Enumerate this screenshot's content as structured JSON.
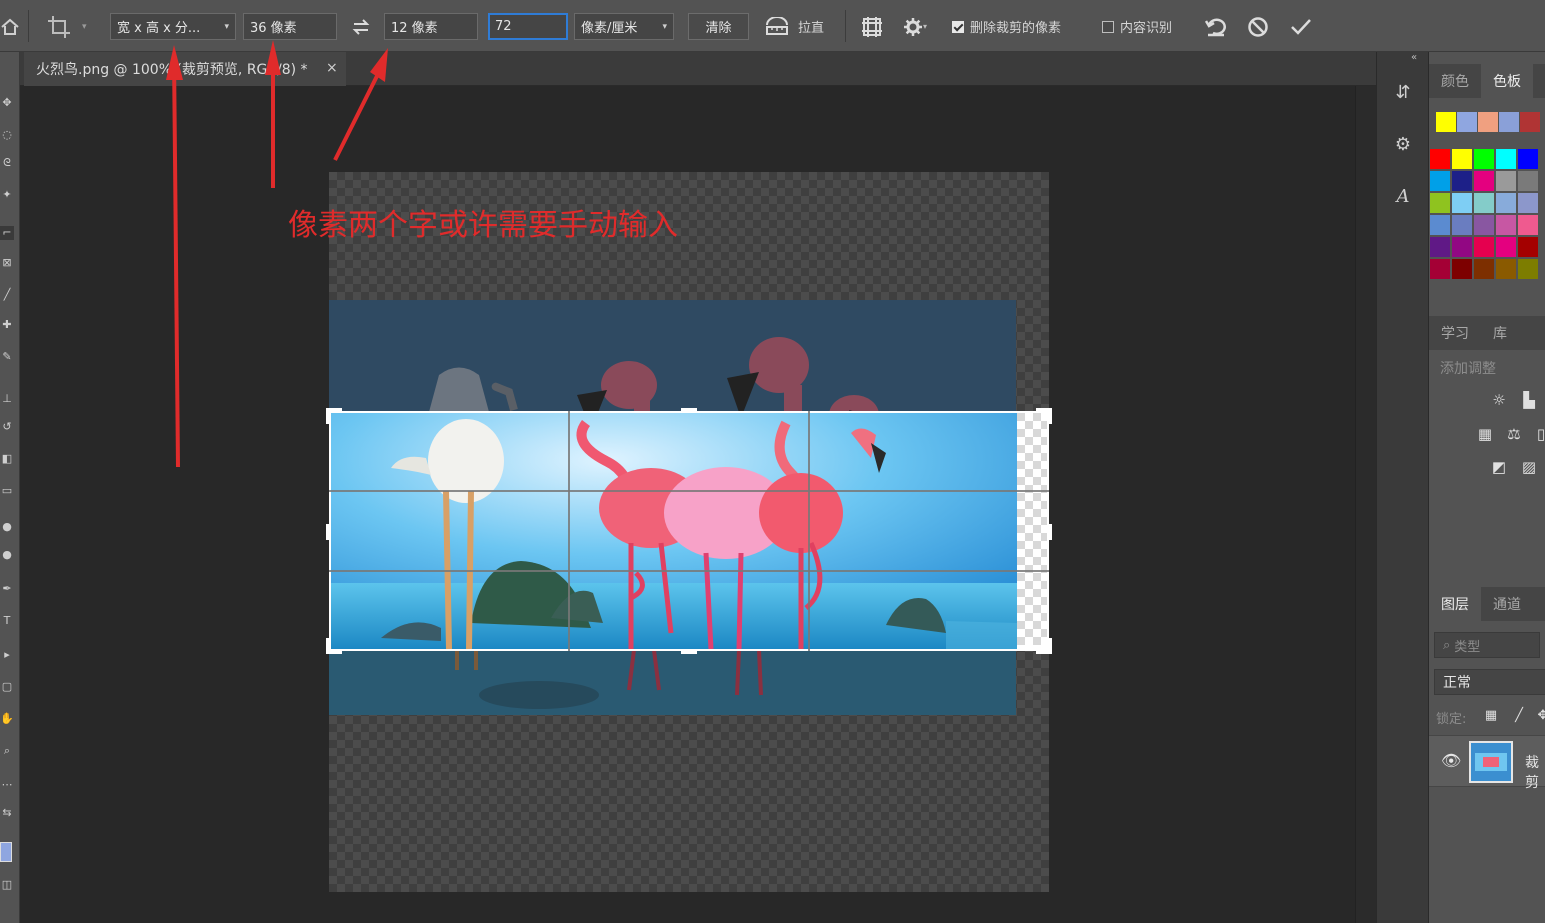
{
  "options_bar": {
    "ratio_preset": "宽 x 高 x 分...",
    "width_value": "36 像素",
    "height_value": "12 像素",
    "resolution_value": "72",
    "resolution_unit": "像素/厘米",
    "clear_label": "清除",
    "straighten_label": "拉直",
    "delete_cropped_label": "删除裁剪的像素",
    "delete_cropped_checked": true,
    "content_aware_label": "内容识别",
    "content_aware_checked": false
  },
  "document": {
    "tab_title": "火烈鸟.png @ 100% (裁剪预览, RGB/8) *",
    "close_glyph": "×"
  },
  "annotation": {
    "text": "像素两个字或许需要手动输入",
    "color": "#e02b2b"
  },
  "right_panel": {
    "collapse_glyph": "«",
    "color_tabs": [
      "颜色",
      "色板"
    ],
    "learn_tabs": [
      "学习",
      "库"
    ],
    "adjustments_title": "添加调整",
    "layers_tabs": [
      "图层",
      "通道"
    ],
    "layer_filter_placeholder": "类型",
    "blend_mode": "正常",
    "lock_label": "锁定:",
    "layer_name": "裁剪"
  },
  "swatches": {
    "recent": [
      "#ffff00",
      "#8fa6e0",
      "#f0a080",
      "#8aa0d8",
      "#b03434"
    ],
    "grid": [
      [
        "#ff0000",
        "#ffff00",
        "#00ff00",
        "#00ffff",
        "#0000ff"
      ],
      [
        "#00a0e8",
        "#1d2088",
        "#e4007f",
        "#9a9a9a",
        "#7a7a7a"
      ],
      [
        "#8fc31f",
        "#7ecef4",
        "#84ccc9",
        "#88abda",
        "#8c97cb"
      ],
      [
        "#5b8bd0",
        "#6a7dc0",
        "#8957a1",
        "#c757a3",
        "#ef5a8f"
      ],
      [
        "#601986",
        "#920783",
        "#e5004f",
        "#e4007f",
        "#a40000"
      ],
      [
        "#a40035",
        "#7d0000",
        "#7d2f00",
        "#8a5a00",
        "#7d7d00"
      ]
    ]
  },
  "colors": {
    "options_bar_bg": "#535353",
    "canvas_bg": "#282828",
    "accent": "#2f7cd6"
  }
}
